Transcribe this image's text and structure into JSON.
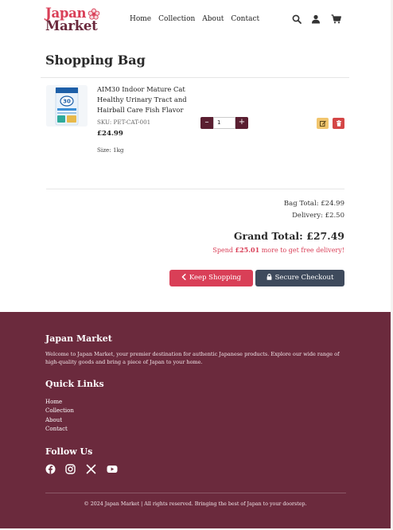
{
  "brand": {
    "line1": "Japan",
    "line2": "Market",
    "primary": "#d93f57",
    "secondary": "#6b2a3d"
  },
  "nav": [
    "Home",
    "Collection",
    "About",
    "Contact"
  ],
  "header_icons": [
    "search-icon",
    "user-icon",
    "cart-icon"
  ],
  "page_title": "Shopping Bag",
  "cart": {
    "items": [
      {
        "name": "AIM30 Indoor Mature Cat Healthy Urinary Tract and Hairball Care Fish Flavor",
        "sku": "SKU: PET-CAT-001",
        "price": "£24.99",
        "size": "Size: 1kg",
        "quantity": "1"
      }
    ]
  },
  "totals": {
    "bag_total": "Bag Total: £24.99",
    "delivery": "Delivery: £2.50",
    "grand_total": "Grand Total: £27.49",
    "free_delivery_amount": "£25.01",
    "free_delivery_text": " more to get free delivery!",
    "spend_prefix": "Spend "
  },
  "buttons": {
    "keep_shopping": "Keep Shopping",
    "secure_checkout": "Secure Checkout"
  },
  "footer": {
    "title": "Japan Market",
    "description": "Welcome to Japan Market, your premier destination for authentic Japanese products. Explore our wide range of high-quality goods and bring a piece of Japan to your home.",
    "quick_links_title": "Quick Links",
    "quick_links": [
      "Home",
      "Collection",
      "About",
      "Contact"
    ],
    "follow_title": "Follow Us",
    "social": [
      "facebook-icon",
      "instagram-icon",
      "x-icon",
      "youtube-icon"
    ],
    "copyright": "© 2024 Japan Market | All rights reserved. Bringing the best of Japan to your doorstep."
  }
}
